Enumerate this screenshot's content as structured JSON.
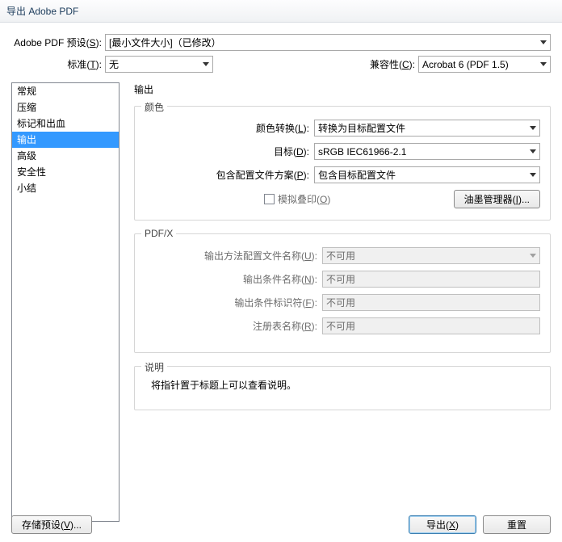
{
  "title": "导出 Adobe PDF",
  "top": {
    "preset_label_pre": "Adobe PDF 预设(",
    "preset_label_u": "S",
    "preset_label_post": "):",
    "preset_value": "[最小文件大小]（已修改）",
    "standard_label_pre": "标准(",
    "standard_label_u": "T",
    "standard_label_post": "):",
    "standard_value": "无",
    "compat_label_pre": "兼容性(",
    "compat_label_u": "C",
    "compat_label_post": "):",
    "compat_value": "Acrobat 6 (PDF 1.5)"
  },
  "sidebar": {
    "items": [
      "常规",
      "压缩",
      "标记和出血",
      "输出",
      "高级",
      "安全性",
      "小结"
    ],
    "selected_index": 3
  },
  "panel": {
    "heading": "输出",
    "color": {
      "group_title": "颜色",
      "conv_label_pre": "颜色转换(",
      "conv_label_u": "L",
      "conv_label_post": "):",
      "conv_value": "转换为目标配置文件",
      "dest_label_pre": "目标(",
      "dest_label_u": "D",
      "dest_label_post": "):",
      "dest_value": "sRGB IEC61966-2.1",
      "profile_label_pre": "包含配置文件方案(",
      "profile_label_u": "P",
      "profile_label_post": "):",
      "profile_value": "包含目标配置文件",
      "sim_label_pre": "模拟叠印(",
      "sim_label_u": "O",
      "sim_label_post": ")",
      "ink_btn_pre": "油墨管理器(",
      "ink_btn_u": "I",
      "ink_btn_post": ")..."
    },
    "pdfx": {
      "group_title": "PDF/X",
      "out_profile_label_pre": "输出方法配置文件名称(",
      "out_profile_label_u": "U",
      "out_profile_label_post": "):",
      "out_profile_value": "不可用",
      "cond_name_label_pre": "输出条件名称(",
      "cond_name_label_u": "N",
      "cond_name_label_post": "):",
      "cond_name_value": "不可用",
      "cond_id_label_pre": "输出条件标识符(",
      "cond_id_label_u": "F",
      "cond_id_label_post": "):",
      "cond_id_value": "不可用",
      "reg_label_pre": "注册表名称(",
      "reg_label_u": "R",
      "reg_label_post": "):",
      "reg_value": "不可用"
    },
    "desc": {
      "group_title": "说明",
      "text": "将指针置于标题上可以查看说明。"
    }
  },
  "bottom": {
    "save_preset_pre": "存储预设(",
    "save_preset_u": "V",
    "save_preset_post": ")...",
    "export_pre": "导出(",
    "export_u": "X",
    "export_post": ")",
    "reset": "重置"
  }
}
